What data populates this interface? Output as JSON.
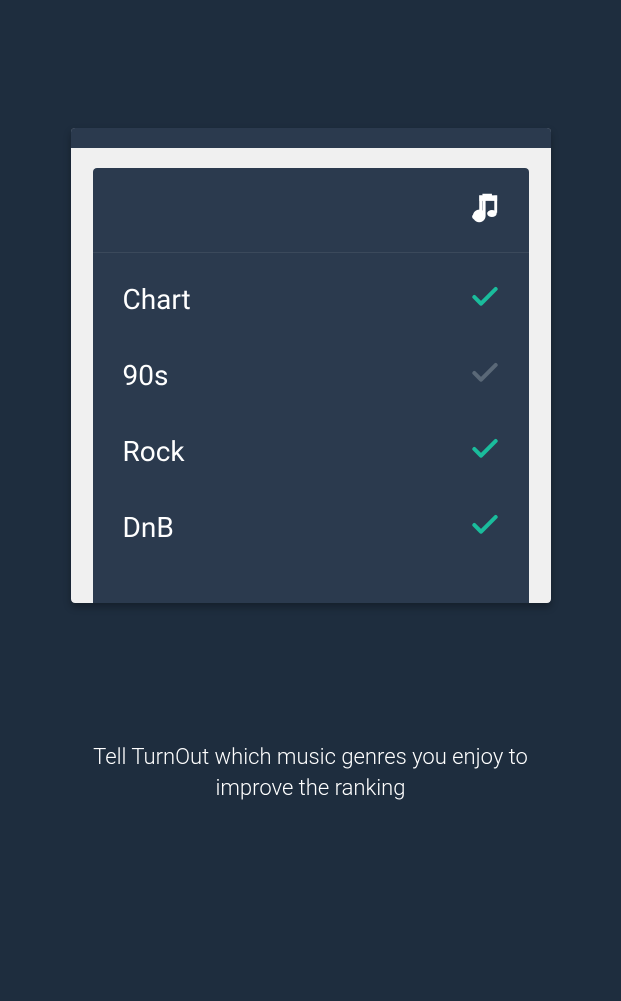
{
  "genres": [
    {
      "label": "Chart",
      "selected": true
    },
    {
      "label": "90s",
      "selected": false
    },
    {
      "label": "Rock",
      "selected": true
    },
    {
      "label": "DnB",
      "selected": true
    }
  ],
  "caption": "Tell TurnOut which music genres you enjoy to improve the ranking",
  "icons": {
    "header": "music-note"
  }
}
